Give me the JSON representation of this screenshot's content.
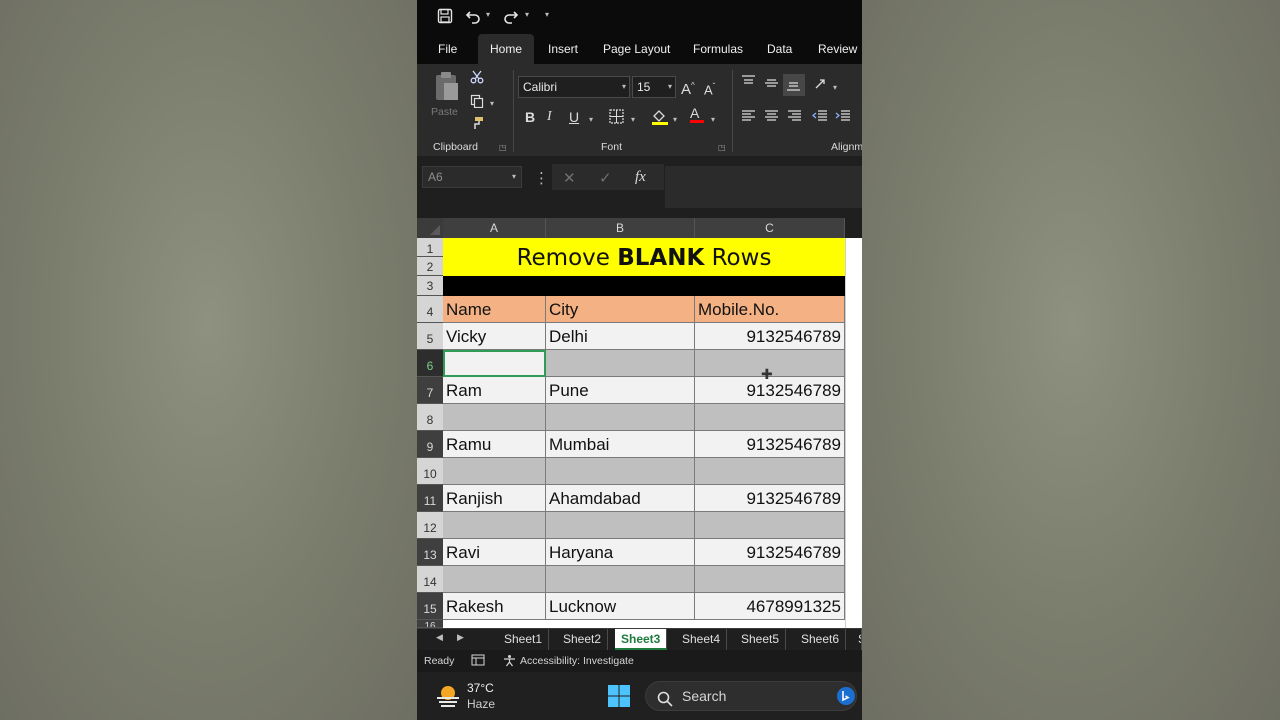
{
  "quick_access": {
    "save_icon": "save-icon",
    "undo_icon": "undo-icon",
    "redo_icon": "redo-icon",
    "customize_icon": "chevron-down-icon"
  },
  "tabs": [
    "File",
    "Home",
    "Insert",
    "Page Layout",
    "Formulas",
    "Data",
    "Review"
  ],
  "active_tab": "Home",
  "ribbon": {
    "clipboard": {
      "paste_label": "Paste",
      "group_label": "Clipboard"
    },
    "font": {
      "font_name": "Calibri",
      "font_size": "15",
      "group_label": "Font"
    },
    "alignment": {
      "group_label": "Alignm"
    }
  },
  "formula_bar": {
    "name_box": "A6",
    "fx": "fx",
    "value": ""
  },
  "columns": [
    "A",
    "B",
    "C"
  ],
  "title": {
    "prefix": "Remove ",
    "bold": "BLANK",
    "suffix": " Rows"
  },
  "row_numbers": [
    "1",
    "2",
    "3",
    "4",
    "5",
    "6",
    "7",
    "8",
    "9",
    "10",
    "11",
    "12",
    "13",
    "14",
    "15",
    "16"
  ],
  "table": {
    "headers": [
      "Name",
      "City",
      "Mobile.No."
    ],
    "rows": [
      [
        "Vicky",
        "Delhi",
        "9132546789"
      ],
      [
        "",
        "",
        ""
      ],
      [
        "Ram",
        "Pune",
        "9132546789"
      ],
      [
        "",
        "",
        ""
      ],
      [
        "Ramu",
        "Mumbai",
        "9132546789"
      ],
      [
        "",
        "",
        ""
      ],
      [
        "Ranjish",
        "Ahamdabad",
        "9132546789"
      ],
      [
        "",
        "",
        ""
      ],
      [
        "Ravi",
        "Haryana",
        "9132546789"
      ],
      [
        "",
        "",
        ""
      ],
      [
        "Rakesh",
        "Lucknow",
        "4678991325"
      ]
    ]
  },
  "sheets": [
    "Sheet1",
    "Sheet2",
    "Sheet3",
    "Sheet4",
    "Sheet5",
    "Sheet6"
  ],
  "active_sheet": "Sheet3",
  "status": {
    "ready": "Ready",
    "accessibility": "Accessibility: Investigate"
  },
  "taskbar": {
    "temperature": "37°C",
    "condition": "Haze",
    "search_placeholder": "Search"
  }
}
